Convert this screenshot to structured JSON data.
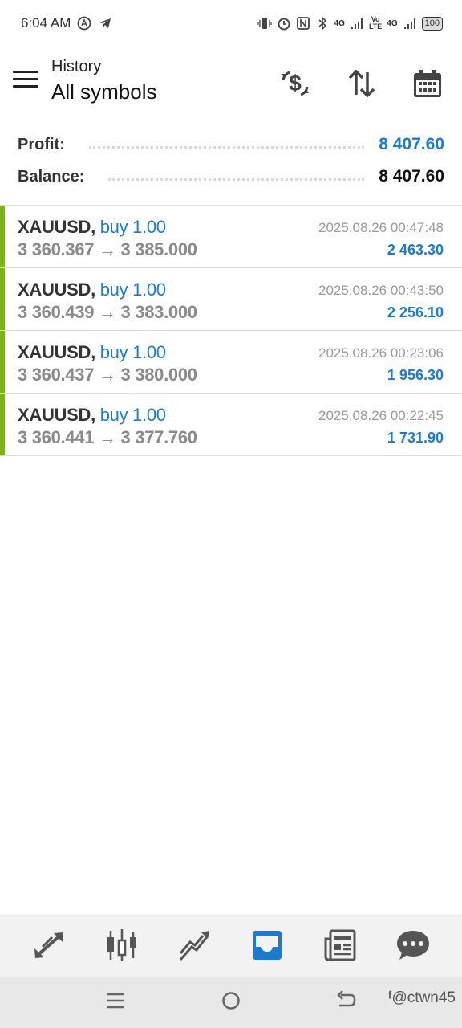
{
  "status_bar": {
    "time": "6:04 AM",
    "network_1": "4G",
    "network_2": "Vo\nLTE",
    "network_3": "4G",
    "battery": "100"
  },
  "header": {
    "subtitle": "History",
    "title": "All symbols",
    "icons": [
      "currency-exchange-icon",
      "sort-icon",
      "calendar-icon"
    ]
  },
  "summary": {
    "profit_label": "Profit:",
    "profit_value": "8 407.60",
    "balance_label": "Balance:",
    "balance_value": "8 407.60"
  },
  "trades": [
    {
      "symbol": "XAUUSD,",
      "side": "buy 1.00",
      "open": "3 360.367",
      "arrow": "→",
      "close": "3 385.000",
      "time": "2025.08.26 00:47:48",
      "profit": "2 463.30"
    },
    {
      "symbol": "XAUUSD,",
      "side": "buy 1.00",
      "open": "3 360.439",
      "arrow": "→",
      "close": "3 383.000",
      "time": "2025.08.26 00:43:50",
      "profit": "2 256.10"
    },
    {
      "symbol": "XAUUSD,",
      "side": "buy 1.00",
      "open": "3 360.437",
      "arrow": "→",
      "close": "3 380.000",
      "time": "2025.08.26 00:23:06",
      "profit": "1 956.30"
    },
    {
      "symbol": "XAUUSD,",
      "side": "buy 1.00",
      "open": "3 360.441",
      "arrow": "→",
      "close": "3 377.760",
      "time": "2025.08.26 00:22:45",
      "profit": "1 731.90"
    }
  ],
  "bottom_nav": {
    "items": [
      "quotes-icon",
      "chart-icon",
      "trade-icon",
      "history-icon",
      "news-icon",
      "chat-icon"
    ],
    "active": "history-icon",
    "active_color": "#1a7ccf",
    "inactive_color": "#555555"
  },
  "watermark": "@ctwn45",
  "colors": {
    "accent": "#1a7ccf",
    "buy_bar": "#7cb518"
  }
}
